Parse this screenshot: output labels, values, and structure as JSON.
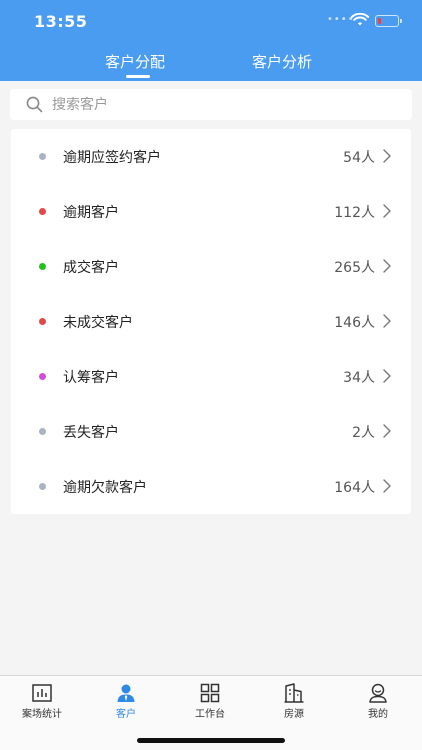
{
  "status_bar": {
    "time": "13:55"
  },
  "tabs": [
    {
      "label": "客户分配",
      "active": true
    },
    {
      "label": "客户分析",
      "active": false
    }
  ],
  "search": {
    "placeholder": "搜索客户"
  },
  "customer_groups": [
    {
      "label": "逾期应签约客户",
      "count": "54人",
      "dot_color": "#a9b3c1"
    },
    {
      "label": "逾期客户",
      "count": "112人",
      "dot_color": "#e24848"
    },
    {
      "label": "成交客户",
      "count": "265人",
      "dot_color": "#22c11e"
    },
    {
      "label": "未成交客户",
      "count": "146人",
      "dot_color": "#e24848"
    },
    {
      "label": "认筹客户",
      "count": "34人",
      "dot_color": "#d04fd6"
    },
    {
      "label": "丢失客户",
      "count": "2人",
      "dot_color": "#a9b3c1"
    },
    {
      "label": "逾期欠款客户",
      "count": "164人",
      "dot_color": "#a9b3c1"
    }
  ],
  "bottom_nav": [
    {
      "label": "案场统计",
      "icon": "chart-icon",
      "active": false
    },
    {
      "label": "客户",
      "icon": "user-icon",
      "active": true
    },
    {
      "label": "工作台",
      "icon": "grid-icon",
      "active": false
    },
    {
      "label": "房源",
      "icon": "building-icon",
      "active": false
    },
    {
      "label": "我的",
      "icon": "profile-icon",
      "active": false
    }
  ],
  "colors": {
    "header": "#4a9cf1",
    "active_nav": "#2f8ae5"
  }
}
